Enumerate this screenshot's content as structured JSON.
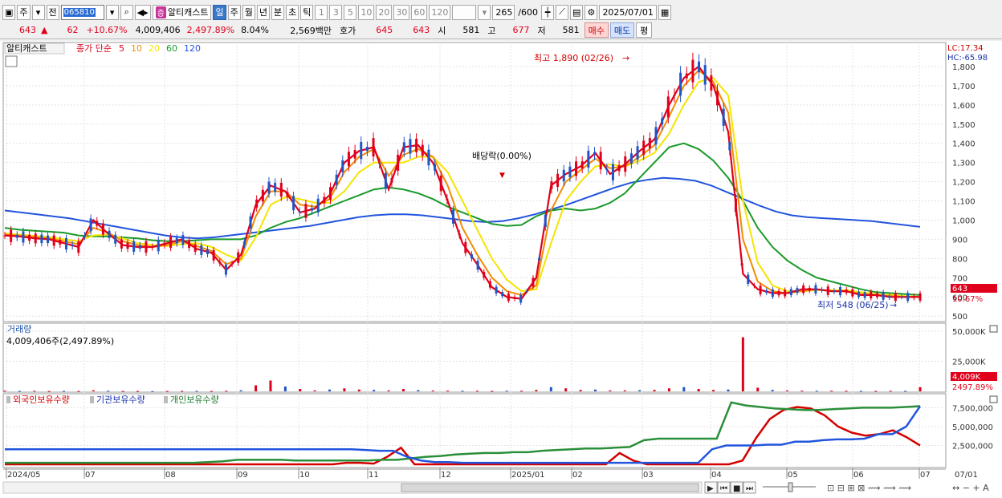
{
  "toolbar": {
    "market": "주",
    "period_kind": "전",
    "stock_code": "065810",
    "stock_name": "알티캐스트",
    "stock_badge": "증",
    "periods": [
      "일",
      "주",
      "월",
      "년",
      "분",
      "초",
      "틱"
    ],
    "active_period": "일",
    "intervals": [
      "1",
      "3",
      "5",
      "10",
      "20",
      "30",
      "60",
      "120"
    ],
    "count": "265",
    "count_max": "/600",
    "date": "2025/07/01"
  },
  "quote": {
    "price": "643",
    "price_arrow": "▲",
    "change": "62",
    "change_pct": "+10.67%",
    "volume": "4,009,406",
    "volume_pct": "2,497.89%",
    "turnover_pct": "8.04%",
    "amount": "2,569백만",
    "ask_label": "호가",
    "ask": "645",
    "bid": "643",
    "open_label": "시",
    "open": "581",
    "high_label": "고",
    "high": "677",
    "low_label": "저",
    "low": "581",
    "buy_label": "매수",
    "sell_label": "매도",
    "avg_label": "평"
  },
  "chart_data": [
    {
      "type": "candlestick",
      "title": "알티캐스트",
      "legend": {
        "label": "종가 단순",
        "periods": [
          {
            "p": "5",
            "color": "#e0001b"
          },
          {
            "p": "10",
            "color": "#f28c00"
          },
          {
            "p": "20",
            "color": "#f5e400"
          },
          {
            "p": "60",
            "color": "#1a9a2a"
          },
          {
            "p": "120",
            "color": "#2255dd"
          }
        ]
      },
      "y_ticks": [
        "1,800",
        "1,700",
        "1,600",
        "1,500",
        "1,400",
        "1,300",
        "1,200",
        "1,100",
        "1,000",
        "900",
        "800",
        "700",
        "600",
        "500"
      ],
      "ylim": [
        480,
        1900
      ],
      "x_ticks": [
        "2024/05",
        "07",
        "08",
        "09",
        "10",
        "11",
        "12",
        "2025/01",
        "02",
        "03",
        "04",
        "05",
        "06",
        "07",
        "07/01"
      ],
      "annotations": {
        "high": "최고 1,890 (02/26)",
        "low": "최저 548 (06/25)",
        "dividend": "배당락(0.00%)"
      },
      "scale_info": {
        "lc": "LC:17.34",
        "hc": "HC:-65.98"
      },
      "last_price_tag": "643",
      "last_change_tag": "10.67%",
      "series": [
        {
          "name": "5",
          "color": "#e0001b",
          "values": [
            920,
            915,
            905,
            900,
            880,
            860,
            1000,
            930,
            870,
            860,
            860,
            880,
            900,
            850,
            830,
            740,
            820,
            1080,
            1180,
            1150,
            1040,
            1060,
            1130,
            1300,
            1360,
            1380,
            1160,
            1380,
            1390,
            1300,
            1100,
            880,
            770,
            650,
            600,
            590,
            700,
            1180,
            1240,
            1280,
            1350,
            1240,
            1290,
            1360,
            1420,
            1600,
            1740,
            1800,
            1700,
            1460,
            720,
            640,
            620,
            620,
            640,
            640,
            630,
            630,
            610,
            610,
            600,
            600,
            600
          ]
        },
        {
          "name": "10",
          "color": "#f28c00",
          "values": [
            925,
            920,
            912,
            905,
            890,
            875,
            960,
            935,
            890,
            870,
            860,
            870,
            890,
            865,
            840,
            770,
            800,
            1020,
            1150,
            1150,
            1080,
            1070,
            1110,
            1250,
            1330,
            1370,
            1230,
            1340,
            1370,
            1330,
            1180,
            960,
            820,
            700,
            630,
            610,
            660,
            1050,
            1200,
            1260,
            1320,
            1270,
            1280,
            1330,
            1390,
            1540,
            1700,
            1780,
            1720,
            1560,
            900,
            680,
            630,
            620,
            630,
            640,
            630,
            630,
            615,
            610,
            605,
            600,
            600
          ]
        },
        {
          "name": "20",
          "color": "#f5e400",
          "values": [
            930,
            925,
            918,
            912,
            900,
            890,
            920,
            925,
            905,
            880,
            870,
            865,
            875,
            880,
            860,
            820,
            790,
            910,
            1080,
            1120,
            1110,
            1090,
            1090,
            1150,
            1250,
            1300,
            1300,
            1300,
            1330,
            1330,
            1250,
            1100,
            950,
            800,
            690,
            630,
            640,
            880,
            1100,
            1200,
            1280,
            1290,
            1280,
            1310,
            1350,
            1450,
            1600,
            1720,
            1740,
            1650,
            1100,
            780,
            660,
            630,
            630,
            635,
            635,
            635,
            625,
            615,
            610,
            605,
            600
          ]
        },
        {
          "name": "60",
          "color": "#1a9a2a",
          "values": [
            960,
            950,
            945,
            940,
            935,
            920,
            915,
            915,
            910,
            905,
            895,
            890,
            890,
            895,
            900,
            900,
            900,
            920,
            960,
            990,
            1010,
            1040,
            1070,
            1100,
            1130,
            1160,
            1170,
            1160,
            1140,
            1110,
            1070,
            1040,
            1010,
            980,
            970,
            975,
            1020,
            1050,
            1060,
            1050,
            1060,
            1090,
            1140,
            1220,
            1300,
            1380,
            1400,
            1370,
            1310,
            1220,
            1100,
            960,
            860,
            790,
            740,
            700,
            680,
            660,
            640,
            625,
            620,
            615,
            610
          ]
        },
        {
          "name": "120",
          "color": "#2255dd",
          "values": [
            1050,
            1040,
            1030,
            1020,
            1010,
            995,
            980,
            965,
            950,
            935,
            920,
            910,
            905,
            910,
            920,
            930,
            940,
            950,
            960,
            970,
            985,
            1000,
            1015,
            1025,
            1030,
            1030,
            1025,
            1015,
            1005,
            995,
            990,
            995,
            1010,
            1030,
            1055,
            1080,
            1110,
            1140,
            1170,
            1195,
            1210,
            1220,
            1215,
            1205,
            1180,
            1145,
            1110,
            1075,
            1045,
            1025,
            1015,
            1010,
            1005,
            1000,
            995,
            985,
            975,
            965
          ]
        }
      ]
    },
    {
      "type": "bar",
      "title": "거래량",
      "value_label": "4,009,406주(2,497.89%)",
      "y_ticks": [
        "50,000K",
        "25,000K"
      ],
      "last_tag": "4,009K",
      "last_pct_tag": "2497.89%",
      "values": [
        0.6,
        0.4,
        0.5,
        0.3,
        0.4,
        0.3,
        0.9,
        0.5,
        0.3,
        0.3,
        0.2,
        0.3,
        0.4,
        0.4,
        0.3,
        0.5,
        0.9,
        5.0,
        9.0,
        4.0,
        2.0,
        0.8,
        1.5,
        2.5,
        1.5,
        1.2,
        0.8,
        2.0,
        1.0,
        0.7,
        0.6,
        0.5,
        0.5,
        0.4,
        0.6,
        0.5,
        1.2,
        3.5,
        2.5,
        1.2,
        1.5,
        0.8,
        0.8,
        1.0,
        1.2,
        2.5,
        3.5,
        2.0,
        1.2,
        1.5,
        45.0,
        3.0,
        1.2,
        0.7,
        0.6,
        0.5,
        0.6,
        0.5,
        0.4,
        0.4,
        0.5,
        0.4,
        3.5
      ]
    },
    {
      "type": "line",
      "title": "",
      "legend": [
        "외국인보유수량",
        "기관보유수량",
        "개인보유수량"
      ],
      "y_ticks": [
        "7,500,000",
        "5,000,000",
        "2,500,000"
      ],
      "series": [
        {
          "name": "외국인보유수량",
          "color": "#d40000",
          "values": [
            0,
            0,
            0,
            0,
            0,
            0,
            0,
            0,
            0,
            0,
            0,
            0,
            0,
            0,
            0,
            0,
            0,
            0,
            0,
            0,
            0,
            0,
            0,
            0,
            0,
            0.2,
            0.2,
            0.1,
            1,
            2.2,
            0,
            0,
            0,
            0,
            0,
            0,
            0,
            0,
            0,
            0,
            0,
            0,
            0,
            0,
            0,
            1.5,
            0.5,
            0,
            0,
            0,
            0,
            0,
            0,
            0,
            0.5,
            3.5,
            6,
            7.2,
            7.6,
            7.4,
            6.5,
            5,
            4.2,
            3.8,
            4,
            4.5,
            3.6,
            2.5
          ]
        },
        {
          "name": "기관보유수량",
          "color": "#2a8f3a",
          "values": [
            0.2,
            0.2,
            0.2,
            0.2,
            0.2,
            0.2,
            0.2,
            0.2,
            0.2,
            0.2,
            0.2,
            0.2,
            0.2,
            0.2,
            0.3,
            0.4,
            0.6,
            0.6,
            0.6,
            0.6,
            0.5,
            0.5,
            0.5,
            0.5,
            0.5,
            0.5,
            0.6,
            0.6,
            0.8,
            1,
            1.1,
            1.3,
            1.4,
            1.5,
            1.5,
            1.6,
            1.6,
            1.8,
            1.9,
            2,
            2.1,
            2.1,
            2.2,
            2.3,
            3.2,
            3.4,
            3.4,
            3.4,
            3.4,
            3.4,
            8.2,
            7.8,
            7.6,
            7.4,
            7.3,
            7.2,
            7.2,
            7.3,
            7.4,
            7.5,
            7.5,
            7.5,
            7.6,
            7.7
          ]
        },
        {
          "name": "개인보유수량",
          "color": "#2255dd",
          "values": [
            2,
            2,
            2,
            2,
            2,
            2,
            2,
            2,
            2,
            2,
            2,
            2,
            2,
            2,
            2,
            2,
            2,
            2,
            2,
            2,
            2,
            2,
            2,
            2,
            2,
            2,
            1.9,
            1.8,
            1.8,
            1.0,
            0.5,
            0.3,
            0.3,
            0.2,
            0.2,
            0.2,
            0.2,
            0.2,
            0.2,
            0.2,
            0.2,
            0.2,
            0.2,
            0.2,
            0.2,
            0.2,
            0.2,
            0.2,
            0.2,
            0.2,
            0.2,
            2,
            2.5,
            2.5,
            2.5,
            2.6,
            2.6,
            3,
            3,
            3.2,
            3.3,
            3.3,
            3.4,
            4,
            4,
            5,
            7.7
          ]
        }
      ]
    }
  ],
  "bottom_controls": [
    "▶",
    "⏮",
    "■",
    "⏭"
  ]
}
